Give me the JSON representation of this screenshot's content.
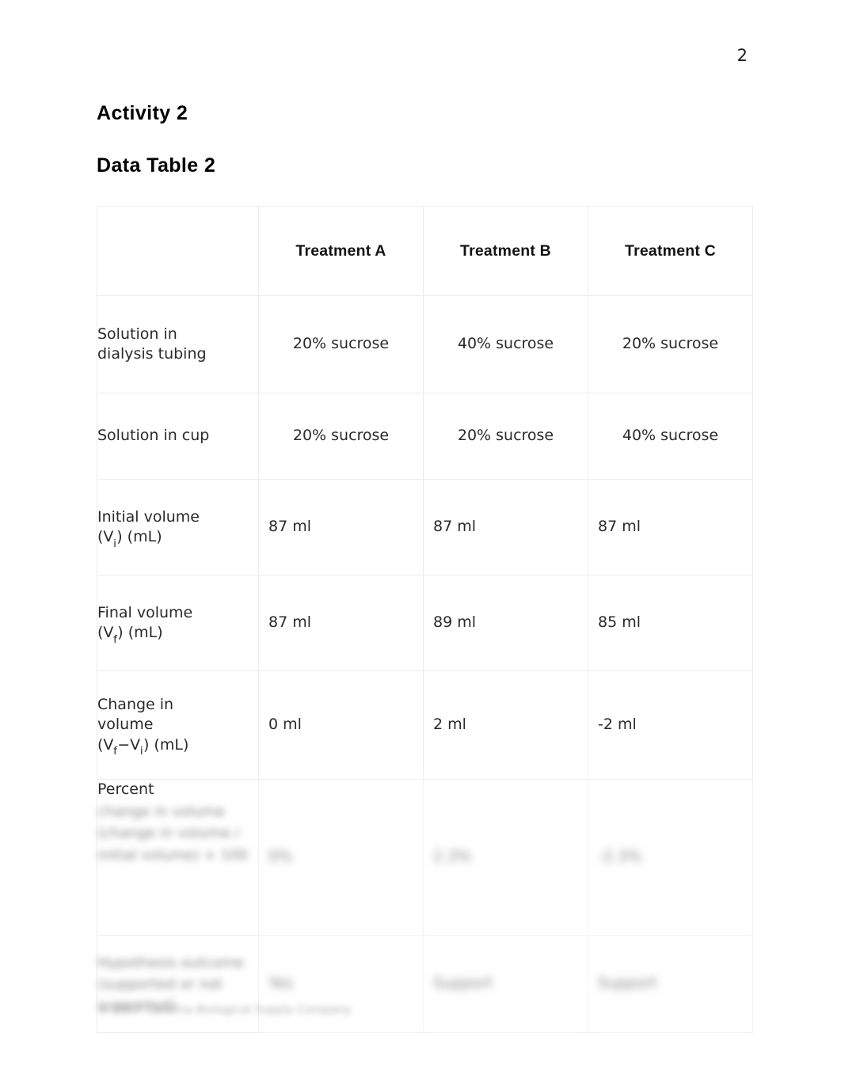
{
  "document": {
    "page_number": "2",
    "headings": {
      "activity": "Activity 2",
      "data_table": "Data Table 2"
    },
    "footer_text": "© 2017 Carolina Biological Supply Company"
  },
  "table": {
    "corner_label": "",
    "columns": [
      {
        "key": "a",
        "header": "Treatment A"
      },
      {
        "key": "b",
        "header": "Treatment B"
      },
      {
        "key": "c",
        "header": "Treatment C"
      }
    ],
    "rows": [
      {
        "id": "solution-in-dialysis-tubing",
        "label_line1": "Solution in",
        "label_line2": "dialysis tubing",
        "align": "center",
        "values": {
          "a": "20% sucrose",
          "b": "40% sucrose",
          "c": "20% sucrose"
        }
      },
      {
        "id": "solution-in-cup",
        "label_line1": "Solution in cup",
        "label_line2": "",
        "align": "center",
        "values": {
          "a": "20% sucrose",
          "b": "20% sucrose",
          "c": "40% sucrose"
        }
      },
      {
        "id": "initial-volume",
        "label_line1": "Initial volume",
        "label_formula_pre": "(V",
        "label_formula_sub": "i",
        "label_formula_post": ") (mL)",
        "align": "left",
        "values": {
          "a": "87 ml",
          "b": "87 ml",
          "c": "87 ml"
        }
      },
      {
        "id": "final-volume",
        "label_line1": "Final volume",
        "label_formula_pre": "(V",
        "label_formula_sub": "f",
        "label_formula_post": ") (mL)",
        "align": "left",
        "values": {
          "a": "87 ml",
          "b": "89 ml",
          "c": "85 ml"
        }
      },
      {
        "id": "change-in-volume",
        "label_line1": "Change in",
        "label_line2": "volume",
        "label_formula_pre": "(V",
        "label_formula_sub": "f",
        "label_formula_mid": "−V",
        "label_formula_sub2": "i",
        "label_formula_post": ") (mL)",
        "align": "left",
        "values": {
          "a": "0 ml",
          "b": "2 ml",
          "c": "-2 ml"
        }
      },
      {
        "id": "percent-change",
        "label_line1": "Percent",
        "label_blurred": "change in volume (change in volume / initial volume) × 100",
        "align": "left",
        "blurred": true,
        "values": {
          "a": "0%",
          "b": "2.3%",
          "c": "-2.3%"
        }
      },
      {
        "id": "hypothesis-outcome",
        "label_line1": "",
        "label_blurred": "Hypothesis outcome (supported or not supported)",
        "align": "left",
        "blurred": true,
        "values": {
          "a": "Yes",
          "b": "Support",
          "c": "Support"
        }
      }
    ]
  }
}
